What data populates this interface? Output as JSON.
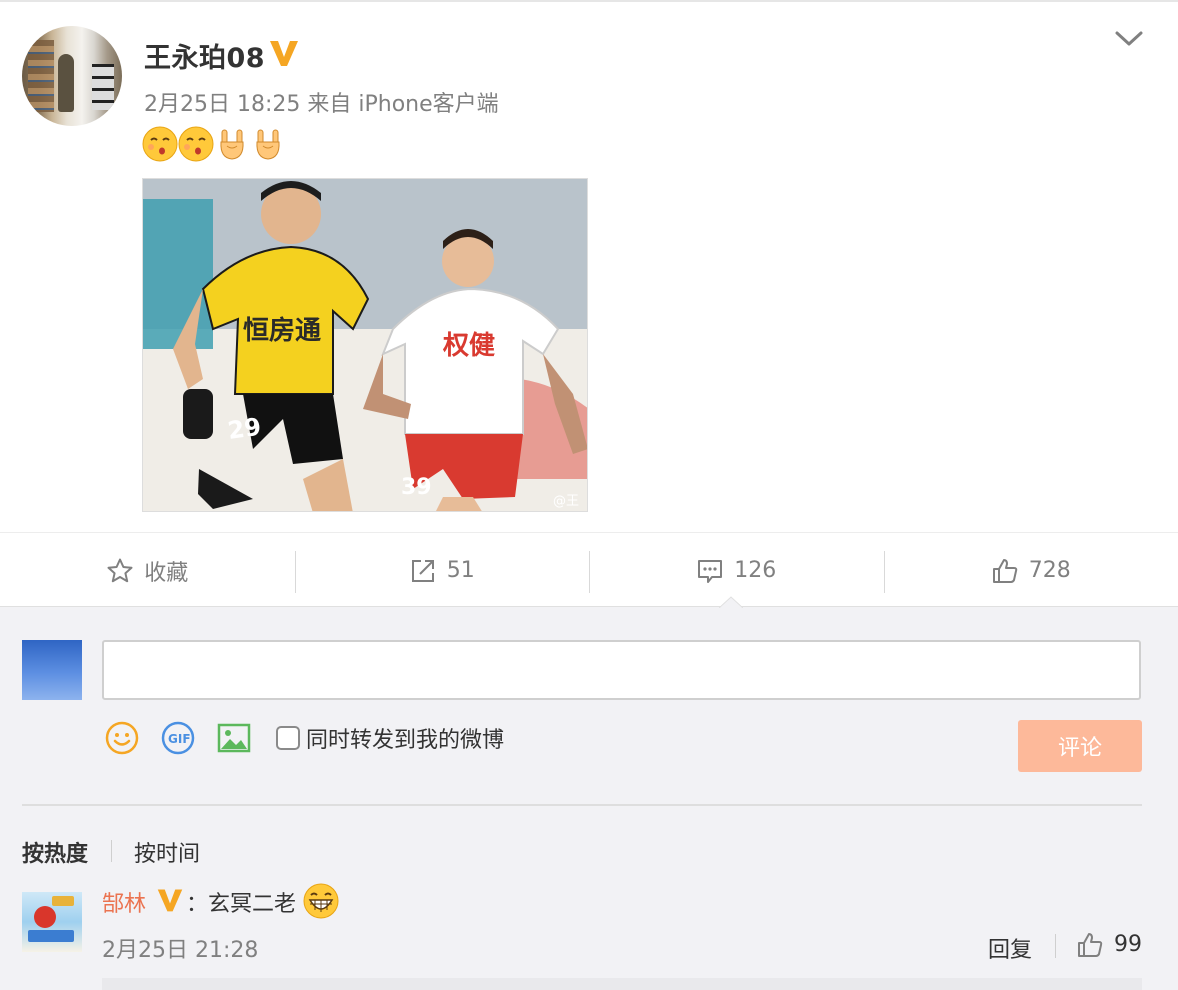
{
  "post": {
    "author": "王永珀08",
    "meta": "2月25日 18:25 来自 iPhone客户端",
    "emojis": [
      "kiss-face",
      "kiss-face",
      "rock-hand",
      "rock-hand"
    ],
    "photo": {
      "jersey_yellow_text": "恒房通",
      "jersey_yellow_number": "29",
      "jersey_white_text": "权健",
      "jersey_white_number": "39",
      "watermark": "@王"
    }
  },
  "actions": {
    "favorite_label": "收藏",
    "repost_count": "51",
    "comment_count": "126",
    "like_count": "728"
  },
  "composer": {
    "input_value": "",
    "repost_checkbox_label": "同时转发到我的微博",
    "submit_label": "评论"
  },
  "sort": {
    "hot_label": "按热度",
    "time_label": "按时间"
  },
  "comment": {
    "author": "郜林",
    "colon": "：",
    "text": "玄冥二老",
    "time": "2月25日 21:28",
    "reply_label": "回复",
    "like_count": "99"
  },
  "colors": {
    "accent_orange": "#eb7350",
    "vip_gold": "#f5a623",
    "submit_disabled": "#fdb99a",
    "muted_text": "#808080"
  }
}
